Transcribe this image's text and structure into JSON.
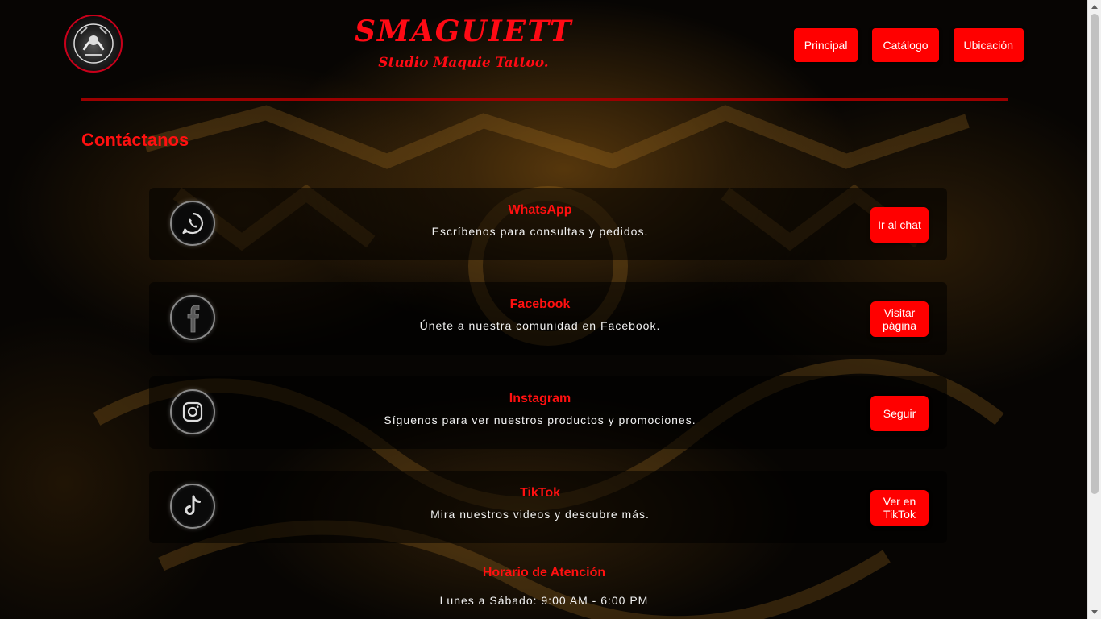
{
  "header": {
    "brand_title": "SMAGUIETT",
    "brand_subtitle": "Studio Maquie Tattoo.",
    "logo_icon": "tattoo-logo-icon",
    "nav": [
      {
        "label": "Principal"
      },
      {
        "label": "Catálogo"
      },
      {
        "label": "Ubicación"
      }
    ]
  },
  "contact": {
    "title": "Contáctanos",
    "cards": [
      {
        "icon": "whatsapp-icon",
        "title": "WhatsApp",
        "description": "Escríbenos para consultas y pedidos.",
        "button": "Ir al chat"
      },
      {
        "icon": "facebook-icon",
        "title": "Facebook",
        "description": "Únete a nuestra comunidad en Facebook.",
        "button": "Visitar página"
      },
      {
        "icon": "instagram-icon",
        "title": "Instagram",
        "description": "Síguenos para ver nuestros productos y promociones.",
        "button": "Seguir"
      },
      {
        "icon": "tiktok-icon",
        "title": "TikTok",
        "description": "Mira nuestros videos y descubre más.",
        "button": "Ver en TikTok"
      }
    ]
  },
  "hours": {
    "title": "Horario de Atención",
    "text": "Lunes a Sábado: 9:00 AM - 6:00 PM"
  },
  "colors": {
    "accent": "#ff0000",
    "divider": "#9c0000",
    "background": "#070503"
  }
}
